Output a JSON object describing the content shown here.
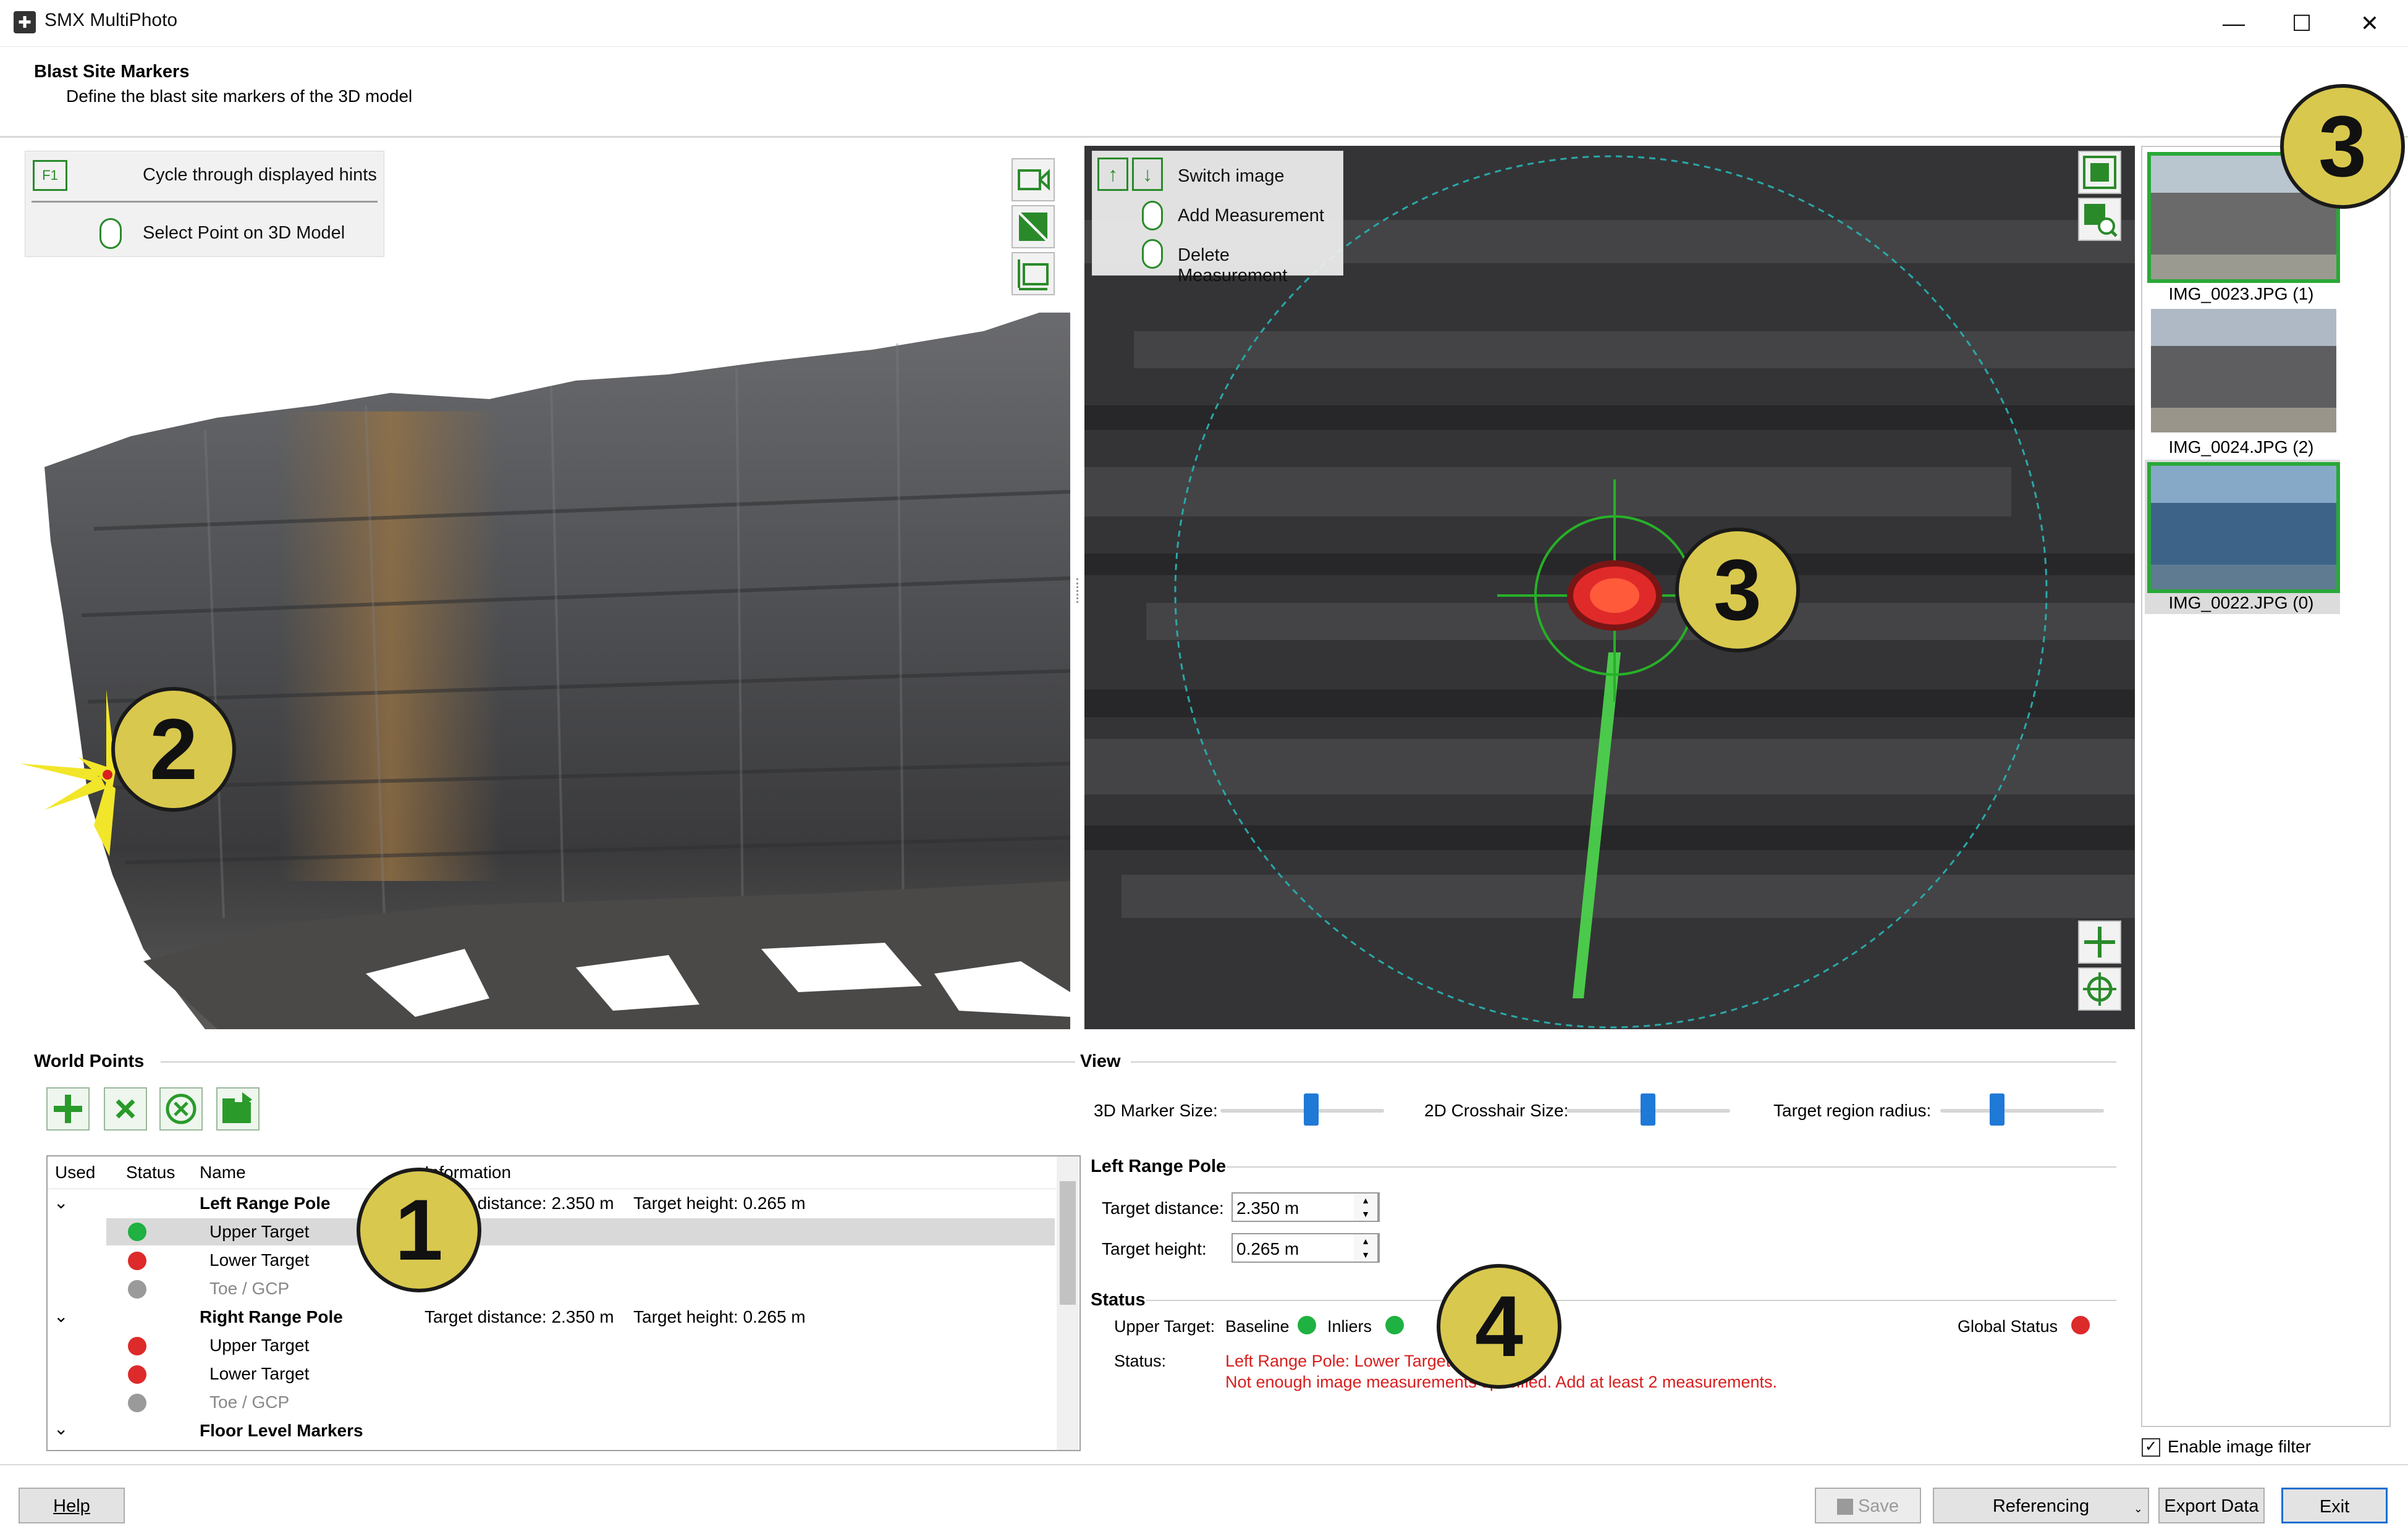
{
  "window": {
    "title": "SMX MultiPhoto",
    "minimize": "—",
    "maximize": "☐",
    "close": "✕"
  },
  "header": {
    "title": "Blast Site Markers",
    "subtitle": "Define the blast site markers of the 3D model"
  },
  "view3d": {
    "hints": [
      {
        "key": "F1",
        "label": "Cycle through displayed hints"
      },
      {
        "key": "mouse",
        "label": "Select Point on 3D Model"
      }
    ],
    "tool_icons": [
      "camera-icon",
      "toggle-texture-icon",
      "fit-view-icon"
    ],
    "callout": "2"
  },
  "view2d": {
    "hints": [
      {
        "label": "Switch image"
      },
      {
        "label": "Add Measurement"
      },
      {
        "label": "Delete Measurement"
      }
    ],
    "tool_icons": [
      "fit-image-icon",
      "zoom-image-icon",
      "center-crosshair-icon",
      "target-icon"
    ],
    "callout": "3"
  },
  "thumbnails": {
    "callout": "3",
    "items": [
      {
        "label": "IMG_0023.JPG (1)",
        "selected": true
      },
      {
        "label": "IMG_0024.JPG (2)",
        "selected": false
      },
      {
        "label": "IMG_0022.JPG (0)",
        "selected": true
      }
    ],
    "filter_label": "Enable image filter",
    "filter_checked": true
  },
  "world_points": {
    "title": "World Points",
    "callout": "1",
    "toolbar_icons": [
      "add-point-icon",
      "remove-point-icon",
      "clear-points-icon",
      "import-points-icon"
    ],
    "columns": [
      "Used",
      "Status",
      "Name",
      "Information"
    ],
    "groups": [
      {
        "name": "Left Range Pole",
        "info_distance": "Target distance: 2.350 m",
        "info_height": "Target height: 0.265 m",
        "children": [
          {
            "name": "Upper Target",
            "status": "green",
            "selected": true
          },
          {
            "name": "Lower Target",
            "status": "red"
          },
          {
            "name": "Toe / GCP",
            "status": "gray",
            "muted": true
          }
        ]
      },
      {
        "name": "Right Range Pole",
        "info_distance": "Target distance: 2.350 m",
        "info_height": "Target height: 0.265 m",
        "children": [
          {
            "name": "Upper Target",
            "status": "red"
          },
          {
            "name": "Lower Target",
            "status": "red"
          },
          {
            "name": "Toe / GCP",
            "status": "gray",
            "muted": true
          }
        ]
      },
      {
        "name": "Floor Level Markers"
      }
    ]
  },
  "view_settings": {
    "title": "View",
    "sliders": [
      {
        "label": "3D Marker Size:",
        "value": 0.55
      },
      {
        "label": "2D Crosshair Size:",
        "value": 0.5
      },
      {
        "label": "Target region radius:",
        "value": 0.35
      }
    ]
  },
  "pole": {
    "title": "Left Range Pole",
    "distance_label": "Target distance:",
    "distance_value": "2.350 m",
    "height_label": "Target height:",
    "height_value": "0.265 m"
  },
  "status": {
    "title": "Status",
    "callout": "4",
    "upper_target_label": "Upper Target:",
    "baseline_label": "Baseline",
    "inliers_label": "Inliers",
    "global_label": "Global Status",
    "status_label": "Status:",
    "message_line1": "Left Range Pole: Lower Target",
    "message_line2": "Not enough image measurements specified. Add at least 2 measurements."
  },
  "footer": {
    "help": "Help",
    "save": "Save",
    "referencing": "Referencing",
    "export": "Export Data",
    "exit": "Exit"
  },
  "colors": {
    "accent_green": "#2a9a2a",
    "status_green": "#1fb141",
    "status_red": "#dd2a2a",
    "status_gray": "#9a9a9a",
    "error_text": "#d81e1e",
    "callout_fill": "#d9c84e"
  }
}
